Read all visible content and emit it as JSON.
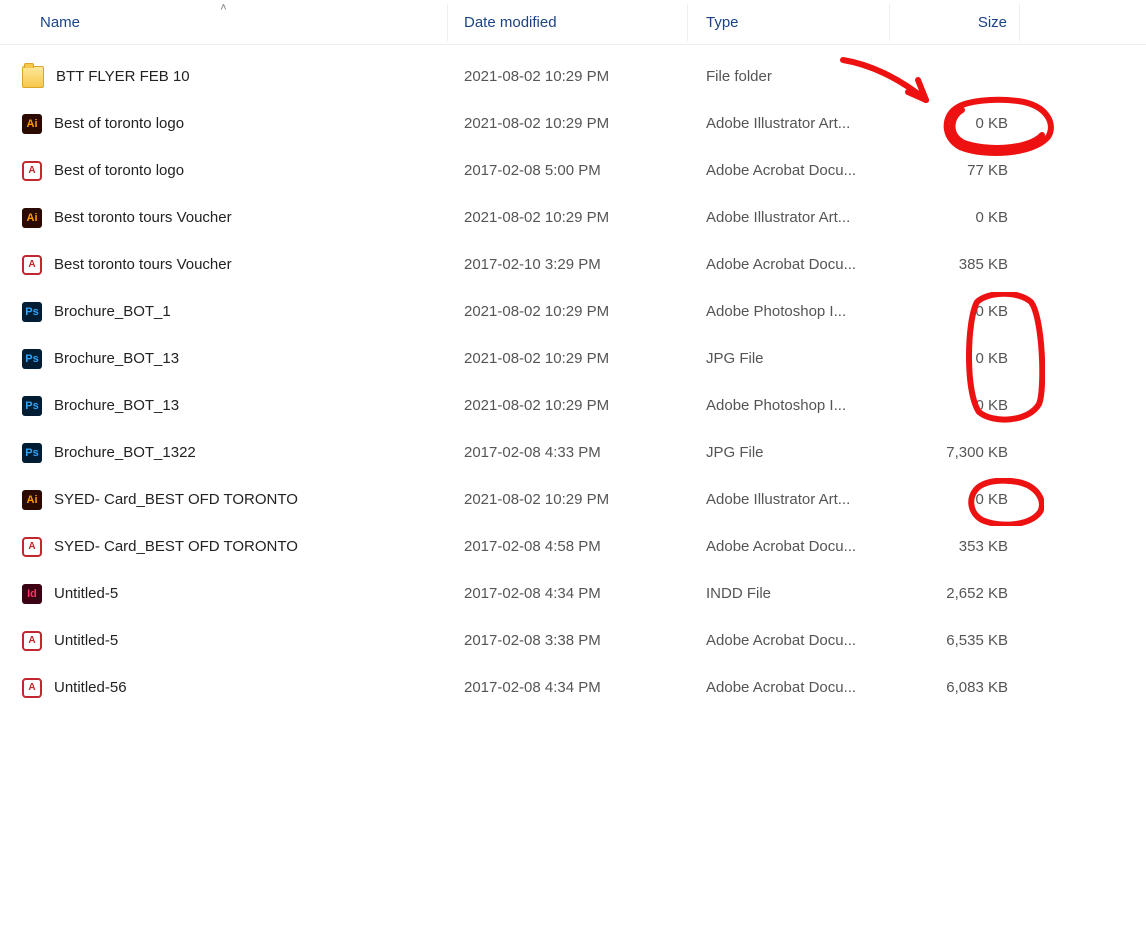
{
  "columns": {
    "name": "Name",
    "date": "Date modified",
    "type": "Type",
    "size": "Size",
    "sort_indicator": "˄"
  },
  "rows": [
    {
      "icon": "folder",
      "name": "BTT FLYER FEB 10",
      "date": "2021-08-02 10:29 PM",
      "type": "File folder",
      "size": ""
    },
    {
      "icon": "ai",
      "name": "Best of toronto logo",
      "date": "2021-08-02 10:29 PM",
      "type": "Adobe Illustrator Art...",
      "size": "0 KB"
    },
    {
      "icon": "pdf",
      "name": "Best of toronto logo",
      "date": "2017-02-08 5:00 PM",
      "type": "Adobe Acrobat Docu...",
      "size": "77 KB"
    },
    {
      "icon": "ai",
      "name": "Best toronto tours Voucher",
      "date": "2021-08-02 10:29 PM",
      "type": "Adobe Illustrator Art...",
      "size": "0 KB"
    },
    {
      "icon": "pdf",
      "name": "Best toronto tours Voucher",
      "date": "2017-02-10 3:29 PM",
      "type": "Adobe Acrobat Docu...",
      "size": "385 KB"
    },
    {
      "icon": "ps",
      "name": "Brochure_BOT_1",
      "date": "2021-08-02 10:29 PM",
      "type": "Adobe Photoshop I...",
      "size": "0 KB"
    },
    {
      "icon": "ps",
      "name": "Brochure_BOT_13",
      "date": "2021-08-02 10:29 PM",
      "type": "JPG File",
      "size": "0 KB"
    },
    {
      "icon": "ps",
      "name": "Brochure_BOT_13",
      "date": "2021-08-02 10:29 PM",
      "type": "Adobe Photoshop I...",
      "size": "0 KB"
    },
    {
      "icon": "ps",
      "name": "Brochure_BOT_1322",
      "date": "2017-02-08 4:33 PM",
      "type": "JPG File",
      "size": "7,300 KB"
    },
    {
      "icon": "ai",
      "name": "SYED- Card_BEST OFD TORONTO",
      "date": "2021-08-02 10:29 PM",
      "type": "Adobe Illustrator Art...",
      "size": "0 KB"
    },
    {
      "icon": "pdf",
      "name": "SYED- Card_BEST OFD TORONTO",
      "date": "2017-02-08 4:58 PM",
      "type": "Adobe Acrobat Docu...",
      "size": "353 KB"
    },
    {
      "icon": "id",
      "name": "Untitled-5",
      "date": "2017-02-08 4:34 PM",
      "type": "INDD File",
      "size": "2,652 KB"
    },
    {
      "icon": "pdf",
      "name": "Untitled-5",
      "date": "2017-02-08 3:38 PM",
      "type": "Adobe Acrobat Docu...",
      "size": "6,535 KB"
    },
    {
      "icon": "pdf",
      "name": "Untitled-56",
      "date": "2017-02-08 4:34 PM",
      "type": "Adobe Acrobat Docu...",
      "size": "6,083 KB"
    }
  ],
  "icon_label": {
    "ai": "Ai",
    "pdf": "A",
    "ps": "Ps",
    "id": "Id",
    "folder": ""
  }
}
